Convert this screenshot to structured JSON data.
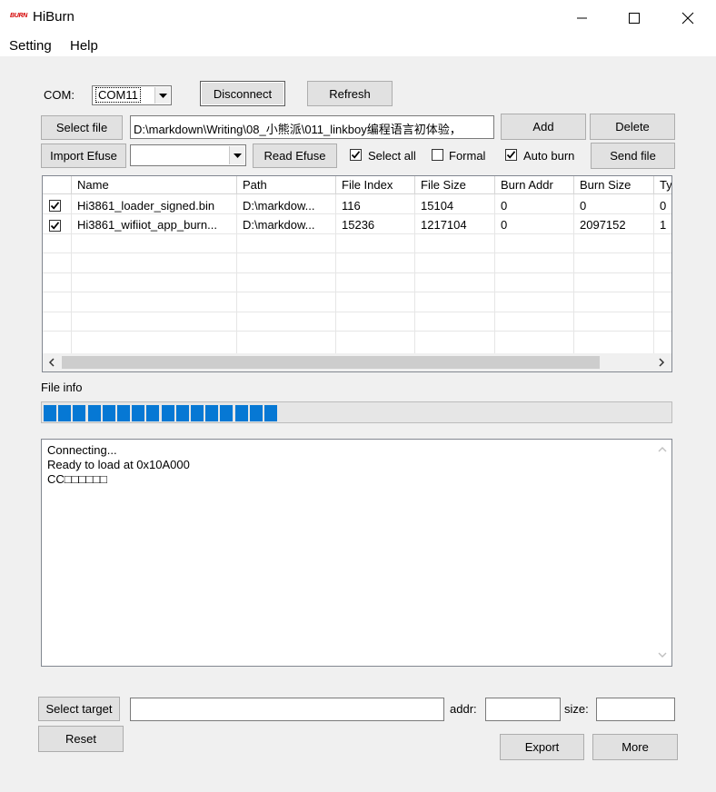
{
  "window": {
    "logo_text": "BURN",
    "title": "HiBurn"
  },
  "menu": [
    "Setting",
    "Help"
  ],
  "com": {
    "label": "COM:",
    "value": "COM11",
    "disconnect_label": "Disconnect",
    "refresh_label": "Refresh"
  },
  "file": {
    "select_label": "Select file",
    "path": "D:\\markdown\\Writing\\08_小熊派\\011_linkboy编程语言初体验，",
    "add_label": "Add",
    "delete_label": "Delete"
  },
  "efuse": {
    "import_label": "Import Efuse",
    "value": "",
    "read_label": "Read Efuse"
  },
  "options": {
    "select_all": {
      "label": "Select all",
      "checked": true
    },
    "formal": {
      "label": "Formal",
      "checked": false
    },
    "auto_burn": {
      "label": "Auto burn",
      "checked": true
    },
    "send_label": "Send file"
  },
  "table": {
    "columns": [
      "",
      "Name",
      "Path",
      "File Index",
      "File Size",
      "Burn Addr",
      "Burn Size",
      "Ty"
    ],
    "rows": [
      {
        "checked": true,
        "name": "Hi3861_loader_signed.bin",
        "path": "D:\\markdow...",
        "index": "116",
        "size": "15104",
        "addr": "0",
        "burn_size": "0",
        "type": "0"
      },
      {
        "checked": true,
        "name": "Hi3861_wifiiot_app_burn...",
        "path": "D:\\markdow...",
        "index": "15236",
        "size": "1217104",
        "addr": "0",
        "burn_size": "2097152",
        "type": "1"
      }
    ]
  },
  "file_info_label": "File info",
  "progress": {
    "filled_blocks": 16,
    "total_blocks": 43,
    "color": "#0678d4"
  },
  "log": {
    "lines": [
      "Connecting...",
      "Ready to load at 0x10A000",
      "CC□□□□□□"
    ]
  },
  "target": {
    "select_label": "Select target",
    "value": "",
    "addr_label": "addr:",
    "addr_value": "",
    "size_label": "size:",
    "size_value": ""
  },
  "bottom": {
    "reset_label": "Reset",
    "export_label": "Export",
    "more_label": "More"
  }
}
